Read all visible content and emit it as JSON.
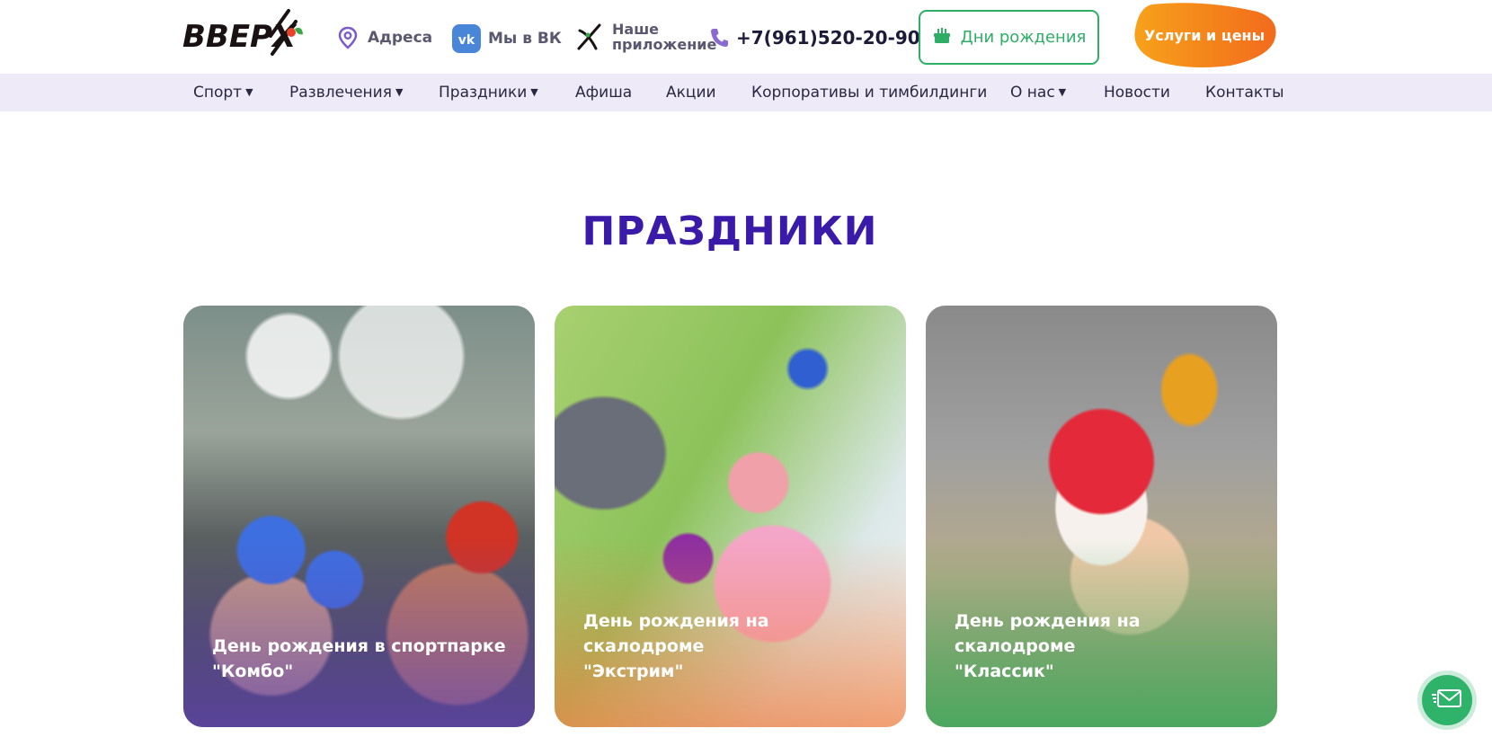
{
  "header": {
    "logo_text": "ВВЕРХ",
    "address_label": "Адреса",
    "vk_label": "Мы в ВК",
    "app_label_line1": "Наше",
    "app_label_line2": "приложение",
    "phone": "+7(961)520-20-90",
    "birthday_button": "Дни рождения",
    "services_button": "Услуги и цены"
  },
  "nav": {
    "items": [
      {
        "label": "Спорт",
        "dropdown": true
      },
      {
        "label": "Развлечения",
        "dropdown": true
      },
      {
        "label": "Праздники",
        "dropdown": true
      },
      {
        "label": "Афиша",
        "dropdown": false
      },
      {
        "label": "Акции",
        "dropdown": false
      },
      {
        "label": "Корпоративы и тимбилдинги",
        "dropdown": false
      },
      {
        "label": "О нас",
        "dropdown": true
      },
      {
        "label": "Новости",
        "dropdown": false
      },
      {
        "label": "Контакты",
        "dropdown": false
      }
    ]
  },
  "main": {
    "title": "ПРАЗДНИКИ",
    "cards": [
      {
        "line1": "День рождения в спортпарке",
        "line2": "\"Комбо\""
      },
      {
        "line1": "День рождения на скалодроме",
        "line2": "\"Экстрим\""
      },
      {
        "line1": "День рождения на скалодроме",
        "line2": "\"Классик\""
      }
    ]
  },
  "icons": {
    "address": "map-pin-icon",
    "vk": "vk-logo-icon",
    "app": "app-logo-icon",
    "phone": "phone-icon",
    "birthday": "cake-icon",
    "floating": "mail-icon"
  },
  "colors": {
    "accent_purple": "#3a1aa8",
    "nav_bg": "#eeeaf8",
    "green": "#2fae67",
    "orange_start": "#f7a11a",
    "orange_end": "#f26b1d",
    "vk_blue": "#4a86d8"
  }
}
